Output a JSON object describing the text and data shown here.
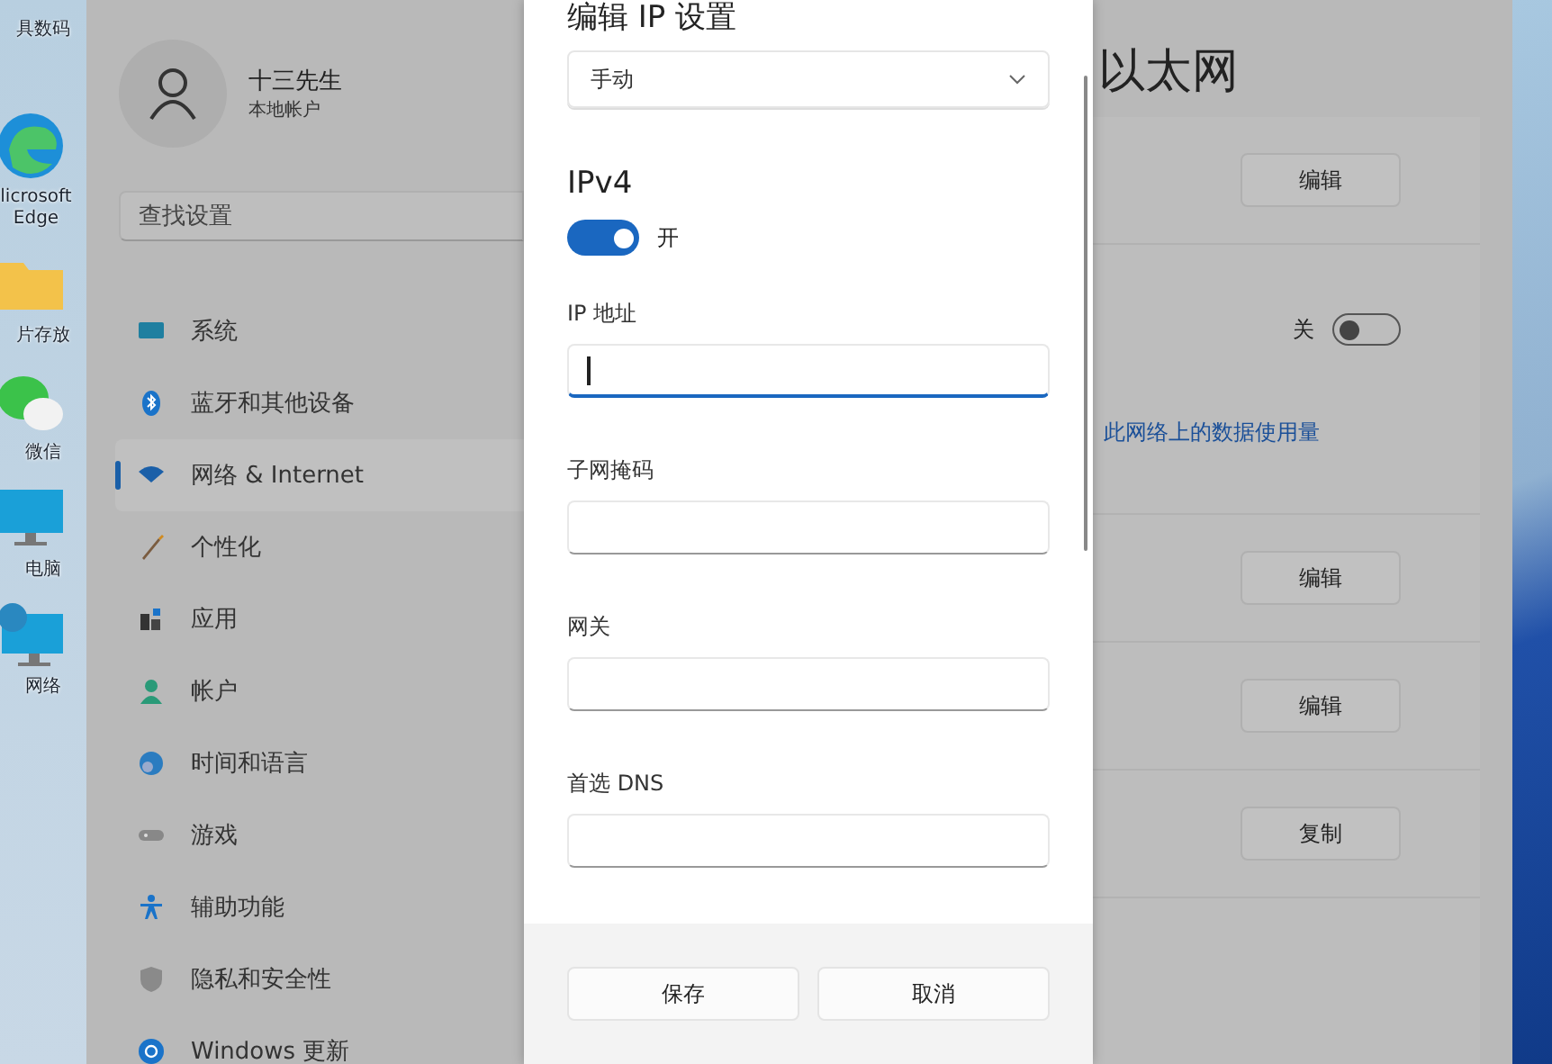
{
  "desktop": {
    "icons": [
      {
        "label": "具数码"
      },
      {
        "label": "licrosoft Edge"
      },
      {
        "label": "片存放"
      },
      {
        "label": "微信"
      },
      {
        "label": "电脑"
      },
      {
        "label": "网络"
      }
    ]
  },
  "settings": {
    "account": {
      "name": "十三先生",
      "type": "本地帐户"
    },
    "search": {
      "placeholder": "查找设置"
    },
    "sidebar": {
      "items": [
        {
          "label": "系统",
          "selected": false
        },
        {
          "label": "蓝牙和其他设备",
          "selected": false
        },
        {
          "label": "网络 & Internet",
          "selected": true
        },
        {
          "label": "个性化",
          "selected": false
        },
        {
          "label": "应用",
          "selected": false
        },
        {
          "label": "帐户",
          "selected": false
        },
        {
          "label": "时间和语言",
          "selected": false
        },
        {
          "label": "游戏",
          "selected": false
        },
        {
          "label": "辅助功能",
          "selected": false
        },
        {
          "label": "隐私和安全性",
          "selected": false
        },
        {
          "label": "Windows 更新",
          "selected": false
        }
      ]
    },
    "page": {
      "title": "以太网",
      "rows": [
        {
          "kind": "button",
          "label": "编辑"
        },
        {
          "kind": "toggle",
          "label": "关",
          "on": false,
          "link": "此网络上的数据使用量"
        },
        {
          "kind": "button",
          "label": "编辑"
        },
        {
          "kind": "button",
          "label": "编辑"
        },
        {
          "kind": "button",
          "label": "复制"
        }
      ]
    }
  },
  "dialog": {
    "title": "编辑 IP 设置",
    "mode": "手动",
    "section": "IPv4",
    "toggle": {
      "on": true,
      "label": "开"
    },
    "fields": [
      {
        "label": "IP 地址",
        "focused": true
      },
      {
        "label": "子网掩码",
        "focused": false
      },
      {
        "label": "网关",
        "focused": false
      },
      {
        "label": "首选 DNS",
        "focused": false
      }
    ],
    "buttons": [
      "保存",
      "取消"
    ]
  }
}
